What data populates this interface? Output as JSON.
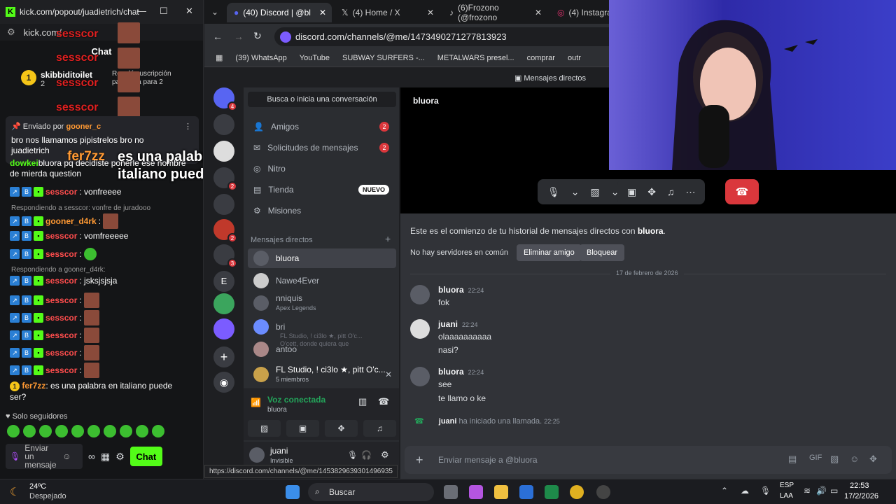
{
  "kick": {
    "window_title": "kick.com/popout/juadietrich/chat",
    "url": "kick.com/",
    "chat_header": "Chat",
    "sub_user": "skibbiditoilet",
    "sub_count": "2",
    "sub_badge": "1",
    "sub_text": "Regaló suscripción para ... la para 2",
    "pinned_label": "Enviado por",
    "pinned_user": "gooner_c",
    "pinned_text": "bro nos llamamos pipistrelos bro no juadietrich",
    "overlay_user": "sesscor",
    "overlay_fer": "fer7zz",
    "overlay_question": "es una palabra en italiano puede ser?",
    "partial_msg_user": "dowkei",
    "partial_msg_text": "bluora pq decidiste ponerle ese nombre de mierda question",
    "msg1_user": "sesscor",
    "msg1_text": ": vonfreeee",
    "reply1": "Respondiendo a sesscor: vonfre de juradooo",
    "msg2_user": "gooner_d4rk",
    "msg3_user": "sesscor",
    "msg3_text": ": vomfreeeee",
    "msg4_user": "sesscor",
    "reply2": "Respondiendo a gooner_d4rk:",
    "msg5_user": "sesscor",
    "msg5_text": ": jsksjsjsja",
    "msg6_user": "sesscor",
    "msg7_user": "sesscor",
    "msg8_user": "sesscor",
    "msg9_user": "sesscor",
    "msg10_user": "sesscor",
    "final_user": "fer7zz",
    "final_text": ": es una palabra en italiano puede ser?",
    "final_badge": "1",
    "followers_only": "Solo seguidores",
    "input_placeholder": "Enviar un mensaje",
    "chat_button": "Chat"
  },
  "chrome": {
    "tabs": [
      {
        "label": "(40) Discord | @bl"
      },
      {
        "label": "(4) Home / X"
      },
      {
        "label": "(6)Frozono (@frozono"
      },
      {
        "label": "(4) Instagram"
      }
    ],
    "address": "discord.com/channels/@me/1473490271277813923",
    "bookmarks": [
      "(39) WhatsApp",
      "YouTube",
      "SUBWAY SURFERS -...",
      "METALWARS presel...",
      "comprar",
      "outr"
    ],
    "status_url": "https://discord.com/channels/@me/1453829639301496935"
  },
  "discord": {
    "top_title": "Mensajes directos",
    "search": "Busca o inicia una conversación",
    "nav": [
      {
        "label": "Amigos",
        "count": "2"
      },
      {
        "label": "Solicitudes de mensajes",
        "count": "2"
      },
      {
        "label": "Nitro",
        "count": ""
      },
      {
        "label": "Tienda",
        "count": ""
      },
      {
        "label": "Misiones",
        "count": ""
      }
    ],
    "nuevo": "NUEVO",
    "dm_header": "Mensajes directos",
    "dms": [
      {
        "name": "bluora",
        "sub": ""
      },
      {
        "name": "Nawe4Ever",
        "sub": ""
      },
      {
        "name": "nniquis",
        "sub": "Apex Legends"
      },
      {
        "name": "bri",
        "sub": ""
      },
      {
        "name": "antoo",
        "sub": ""
      },
      {
        "name": "FL Studio, ! ci3lo ★, pitt O'c...",
        "sub": "5 miembros"
      }
    ],
    "ghost_text": "FL Studio, ! ci3lo ★, pitt O'c...",
    "ghost_text2": "O'cett, donde quiera que",
    "guild_badges": [
      "4",
      "2",
      "2",
      "3"
    ],
    "guild_letter": "E",
    "voice_status": "Voz conectada",
    "voice_channel": "bluora",
    "user_name": "juani",
    "user_status": "Invisible",
    "chat_user": "bluora",
    "intro_text": "Este es el comienzo de tu historial de mensajes directos con ",
    "intro_user": "bluora",
    "no_servers": "No hay servidores en común",
    "remove_friend": "Eliminar amigo",
    "block": "Bloquear",
    "date_divider": "17 de febrero de 2026",
    "messages": [
      {
        "author": "bluora",
        "time": "22:24",
        "lines": [
          "fok"
        ]
      },
      {
        "author": "juani",
        "time": "22:24",
        "lines": [
          "olaaaaaaaaaa",
          "nasi?"
        ]
      },
      {
        "author": "bluora",
        "time": "22:24",
        "lines": [
          "see",
          "te llamo o ke"
        ]
      }
    ],
    "call_author": "juani",
    "call_text": " ha iniciado una llamada.",
    "call_time": "22:25",
    "composer_placeholder": "Enviar mensaje a @bluora"
  },
  "taskbar": {
    "temp": "24ºC",
    "weather": "Despejado",
    "search": "Buscar",
    "lang1": "ESP",
    "lang2": "LAA",
    "time": "22:53",
    "date": "17/2/2026"
  }
}
